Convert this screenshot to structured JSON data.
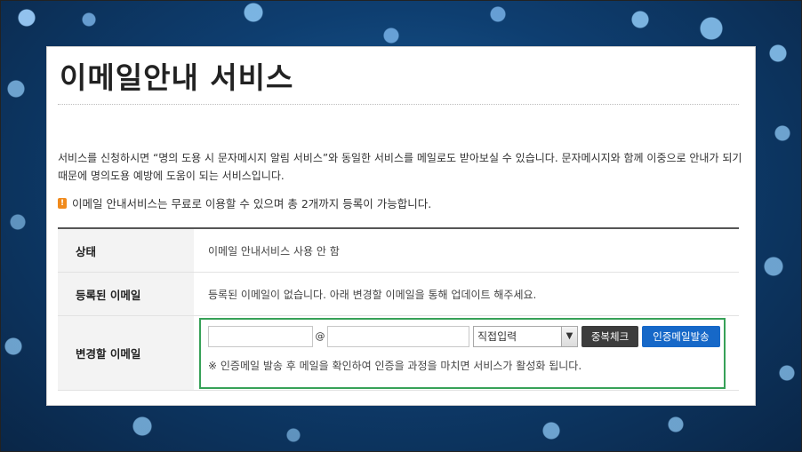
{
  "page": {
    "title": "이메일안내 서비스",
    "intro": "서비스를 신청하시면 “명의 도용 시 문자메시지 알림 서비스”와 동일한 서비스를 메일로도 받아보실 수 있습니다. 문자메시지와 함께 이중으로 안내가 되기 때문에 명의도용 예방에 도움이 되는 서비스입니다.",
    "notice_icon": "!",
    "notice": "이메일 안내서비스는 무료로 이용할 수 있으며 총 2개까지 등록이 가능합니다."
  },
  "table": {
    "status_label": "상태",
    "status_value": "이메일 안내서비스 사용 안 함",
    "registered_label": "등록된 이메일",
    "registered_value": "등록된 이메일이 없습니다. 아래 변경할 이메일을 통해 업데이트 해주세요.",
    "change_label": "변경할 이메일"
  },
  "email_form": {
    "local_value": "",
    "at_symbol": "@",
    "domain_value": "",
    "domain_select": "직접입력",
    "dup_check_label": "중복체크",
    "send_verify_label": "인증메일발송",
    "note": "※ 인증메일 발송 후 메일을 확인하여 인증을 과정을 마치면 서비스가 활성화 됩니다."
  },
  "colors": {
    "highlight_border": "#37a158",
    "verify_button": "#1668c8",
    "dup_button": "#3c3c3c",
    "notice_icon": "#f08a1c"
  }
}
